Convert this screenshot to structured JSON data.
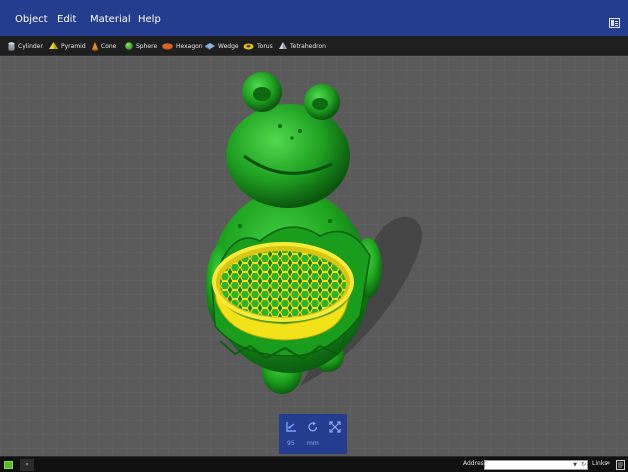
{
  "menu": {
    "items": [
      {
        "id": "object",
        "label": "Object"
      },
      {
        "id": "edit",
        "label": "Edit"
      },
      {
        "id": "material",
        "label": "Material"
      },
      {
        "id": "help",
        "label": "Help"
      }
    ]
  },
  "shapes": [
    {
      "id": "cylinder",
      "label": "Cylinder",
      "icon": "cylinder-icon"
    },
    {
      "id": "pyramid",
      "label": "Pyramid",
      "icon": "pyramid-icon"
    },
    {
      "id": "cone",
      "label": "Cone",
      "icon": "cone-icon"
    },
    {
      "id": "sphere",
      "label": "Sphere",
      "icon": "sphere-icon"
    },
    {
      "id": "hexagon",
      "label": "Hexagon",
      "icon": "hexagon-icon"
    },
    {
      "id": "wedge",
      "label": "Wedge",
      "icon": "wedge-icon"
    },
    {
      "id": "torus",
      "label": "Torus",
      "icon": "torus-icon"
    },
    {
      "id": "tetrahedron",
      "label": "Tetrahedron",
      "icon": "tetrahedron-icon"
    }
  ],
  "gizmo": {
    "value": "95",
    "unit": "mm",
    "tools": [
      "move-icon",
      "rotate-icon",
      "scale-icon"
    ]
  },
  "taskbar": {
    "address_label": "Address",
    "address_value": "",
    "links_label": "Links",
    "chevron": "»"
  },
  "colors": {
    "accent": "#253d8e",
    "toolbar_bg": "#1e1e1e",
    "viewport_bg": "#5a5a5a",
    "model_green": "#1fa51f",
    "basket_yellow": "#f2e21a"
  }
}
